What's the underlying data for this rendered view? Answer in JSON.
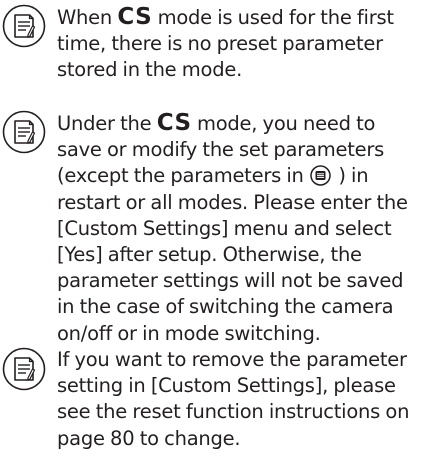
{
  "notes": [
    {
      "icon": "note-icon",
      "before": "When ",
      "mode": "CS",
      "after": " mode is used for the first time, there is no preset parameter stored in the mode."
    },
    {
      "icon": "note-icon",
      "before": "Under the ",
      "mode": "CS",
      "middle": " mode, you need to save or modify the set parameters (except the parameters in ",
      "inline_icon": "menu-icon",
      "after": " ) in restart or all modes. Please enter the [Custom Settings] menu and select [Yes] after setup. Otherwise, the parameter settings will not be saved in the case of switching the camera on/off or in mode switching."
    },
    {
      "icon": "note-icon",
      "text": "If you want to remove the parameter setting in [Custom Settings], please see the reset function instructions on page 80 to change."
    }
  ]
}
